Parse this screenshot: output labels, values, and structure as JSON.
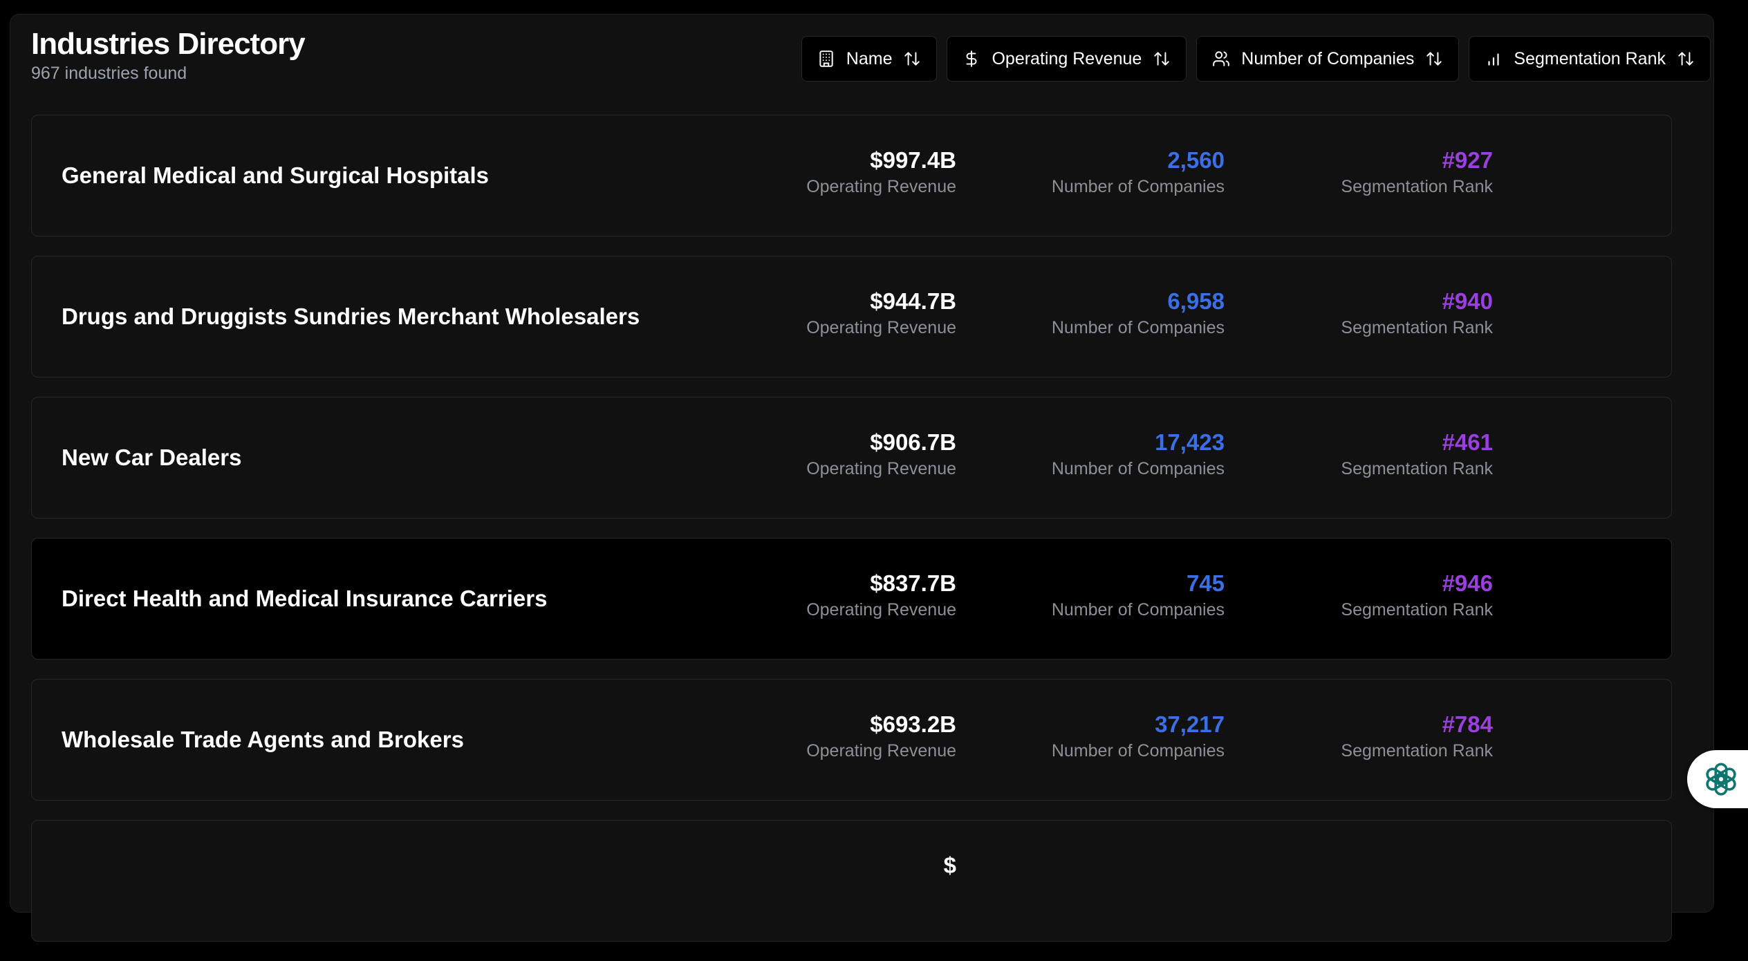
{
  "header": {
    "title": "Industries Directory",
    "count_text": "967 industries found"
  },
  "sort_buttons": [
    {
      "label": "Name",
      "icon": "building-icon"
    },
    {
      "label": "Operating Revenue",
      "icon": "dollar-icon"
    },
    {
      "label": "Number of Companies",
      "icon": "users-icon"
    },
    {
      "label": "Segmentation Rank",
      "icon": "bar-chart-icon"
    }
  ],
  "labels": {
    "revenue": "Operating Revenue",
    "companies": "Number of Companies",
    "rank": "Segmentation Rank"
  },
  "rows": [
    {
      "name": "General Medical and Surgical Hospitals",
      "revenue": "$997.4B",
      "companies": "2,560",
      "rank": "#927"
    },
    {
      "name": "Drugs and Druggists Sundries Merchant Wholesalers",
      "revenue": "$944.7B",
      "companies": "6,958",
      "rank": "#940"
    },
    {
      "name": "New Car Dealers",
      "revenue": "$906.7B",
      "companies": "17,423",
      "rank": "#461"
    },
    {
      "name": "Direct Health and Medical Insurance Carriers",
      "revenue": "$837.7B",
      "companies": "745",
      "rank": "#946"
    },
    {
      "name": "Wholesale Trade Agents and Brokers",
      "revenue": "$693.2B",
      "companies": "37,217",
      "rank": "#784"
    },
    {
      "name": "",
      "revenue": "$",
      "companies": "",
      "rank": ""
    }
  ],
  "colors": {
    "background": "#000000",
    "panel": "#111111",
    "companies_accent": "#3b6fe6",
    "rank_accent": "#9b3fe0",
    "revenue_text": "#ffffff",
    "muted_label": "#8b9099",
    "active_row": "#000000"
  },
  "fab": {
    "icon": "openai-logo-icon"
  }
}
